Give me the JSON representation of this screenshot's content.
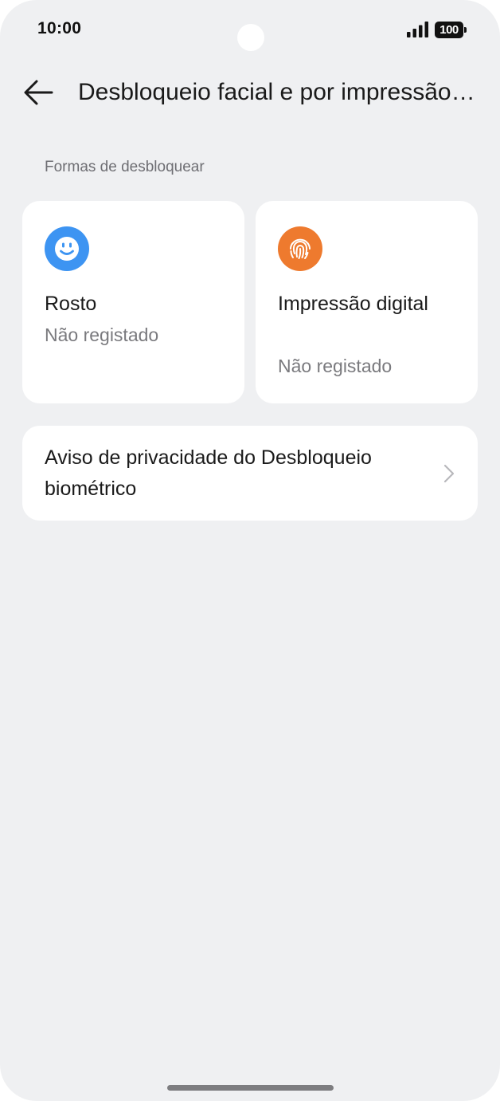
{
  "status_bar": {
    "time": "10:00",
    "battery_level": "100",
    "icons": [
      "signal-icon",
      "battery-icon"
    ]
  },
  "header": {
    "back_icon": "back-arrow-icon",
    "title": "Desbloqueio facial e por impressão digital"
  },
  "section": {
    "label": "Formas de desbloquear"
  },
  "unlock_methods": [
    {
      "title": "Rosto",
      "status": "Não registado",
      "icon": "face-icon",
      "icon_color": "#3d94f2"
    },
    {
      "title": "Impressão digital",
      "status": "Não registado",
      "icon": "fingerprint-icon",
      "icon_color": "#ee7a2e"
    }
  ],
  "privacy": {
    "label": "Aviso de privacidade do Desbloqueio biométrico",
    "icon": "chevron-right-icon"
  },
  "colors": {
    "background": "#eff0f2",
    "card": "#ffffff",
    "face_accent": "#3d94f2",
    "fingerprint_accent": "#ee7a2e"
  }
}
